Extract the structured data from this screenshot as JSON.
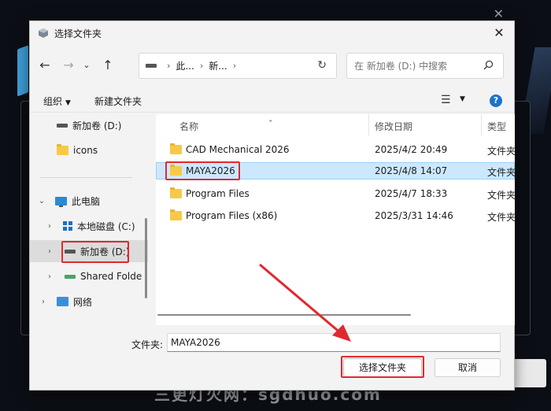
{
  "background": {
    "watermark": "三更灯火网：sgdhuo.com"
  },
  "dialog": {
    "title": "选择文件夹",
    "close_glyph": "✕"
  },
  "navbar": {
    "back_glyph": "←",
    "forward_glyph": "→",
    "recent_glyph": "⌄",
    "up_glyph": "↑",
    "breadcrumbs": [
      "此...",
      "新..."
    ],
    "refresh_glyph": "↻",
    "search_placeholder": "在 新加卷 (D:) 中搜索"
  },
  "toolbar": {
    "organize_label": "组织",
    "new_folder_label": "新建文件夹",
    "help_glyph": "?"
  },
  "tree": {
    "items": [
      {
        "label": "新加卷 (D:)",
        "icon": "drive-icon"
      },
      {
        "label": "icons",
        "icon": "folder-icon"
      },
      {
        "label": "此电脑",
        "icon": "pc-icon"
      },
      {
        "label": "本地磁盘 (C:)",
        "icon": "windows-drive-icon"
      },
      {
        "label": "新加卷 (D:)",
        "icon": "drive-icon"
      },
      {
        "label": "Shared Folde",
        "icon": "shared-drive-icon"
      },
      {
        "label": "网络",
        "icon": "network-icon"
      }
    ]
  },
  "files": {
    "columns": [
      "名称",
      "修改日期",
      "类型"
    ],
    "rows": [
      {
        "name": "CAD Mechanical 2026",
        "date": "2025/4/2 20:49",
        "type": "文件夹"
      },
      {
        "name": "MAYA2026",
        "date": "2025/4/8 14:07",
        "type": "文件夹"
      },
      {
        "name": "Program Files",
        "date": "2025/4/7 18:33",
        "type": "文件夹"
      },
      {
        "name": "Program Files (x86)",
        "date": "2025/3/31 14:46",
        "type": "文件夹"
      }
    ],
    "selected_index": 1
  },
  "footer": {
    "folder_label": "文件夹:",
    "folder_value": "MAYA2026",
    "select_button": "选择文件夹",
    "cancel_button": "取消"
  },
  "colors": {
    "highlight_box": "#e0292f",
    "selection": "#cce8ff"
  }
}
